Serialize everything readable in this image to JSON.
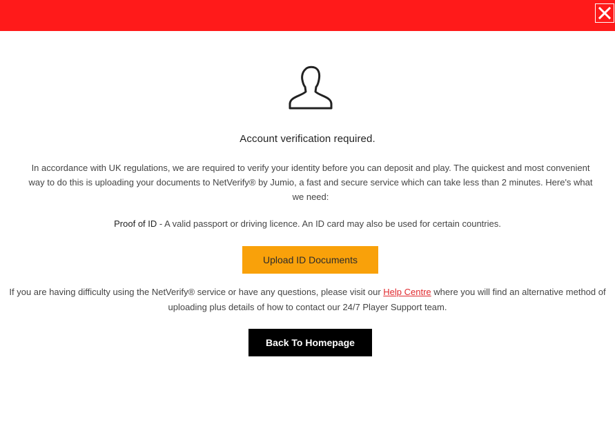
{
  "header": {
    "close_icon": "close-icon",
    "bar_color": "#ff1a1a"
  },
  "main": {
    "avatar_icon": "user-silhouette-icon",
    "title": "Account verification required.",
    "intro": "In accordance with UK regulations, we are required to verify your identity before you can deposit and play. The quickest and most convenient way to do this is uploading your documents to NetVerify® by Jumio, a fast and secure service which can take less than 2 minutes. Here's what we need:",
    "proof_label": "Proof of ID",
    "proof_text": " - A valid passport or driving licence. An ID card may also be used for certain countries.",
    "upload_button": "Upload ID Documents",
    "help_before": "If you are having difficulty using the NetVerify® service or have any questions, please visit our ",
    "help_link": "Help Centre",
    "help_after": " where you will find an alternative method of uploading plus details of how to contact our 24/7 Player Support team.",
    "home_button": "Back To Homepage"
  },
  "colors": {
    "accent_red": "#ff1a1a",
    "upload_button_bg": "#f9a10a",
    "home_button_bg": "#000000",
    "link": "#e0282d"
  }
}
